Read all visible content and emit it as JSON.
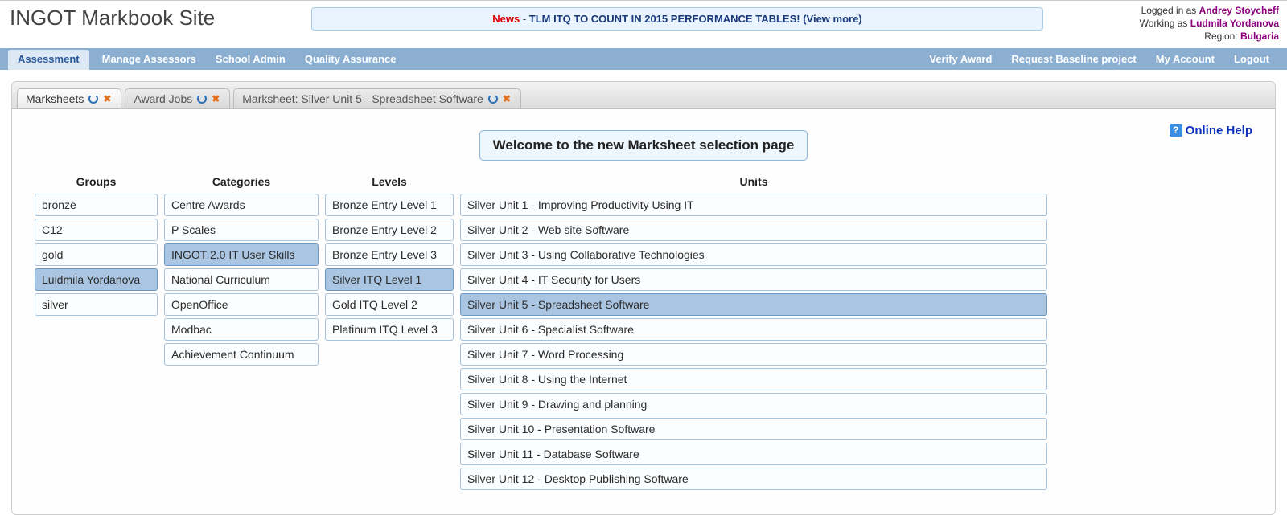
{
  "header": {
    "site_title": "INGOT Markbook Site",
    "news_label": "News",
    "news_sep": " - ",
    "news_text": "TLM ITQ TO COUNT IN 2015 PERFORMANCE TABLES! (View more)",
    "logged_in_as_label": "Logged in as ",
    "logged_in_user": "Andrey Stoycheff",
    "working_as_label": "Working as ",
    "working_as_user": "Ludmila Yordanova",
    "region_label": "Region: ",
    "region_value": "Bulgaria"
  },
  "nav": {
    "left": [
      "Assessment",
      "Manage Assessors",
      "School Admin",
      "Quality Assurance"
    ],
    "right": [
      "Verify Award",
      "Request Baseline project",
      "My Account",
      "Logout"
    ],
    "active_index": 0
  },
  "tabs": [
    {
      "label": "Marksheets",
      "active": true
    },
    {
      "label": "Award Jobs",
      "active": false
    },
    {
      "label": "Marksheet: Silver Unit 5 - Spreadsheet Software",
      "active": false
    }
  ],
  "page": {
    "welcome": "Welcome to the new Marksheet selection page",
    "help_label": "Online Help"
  },
  "columns": {
    "groups": {
      "header": "Groups",
      "items": [
        "bronze",
        "C12",
        "gold",
        "Luidmila Yordanova",
        "silver"
      ],
      "selected_index": 3
    },
    "categories": {
      "header": "Categories",
      "items": [
        "Centre Awards",
        "P Scales",
        "INGOT 2.0 IT User Skills",
        "National Curriculum",
        "OpenOffice",
        "Modbac",
        "Achievement Continuum"
      ],
      "selected_index": 2
    },
    "levels": {
      "header": "Levels",
      "items": [
        "Bronze Entry Level 1",
        "Bronze Entry Level 2",
        "Bronze Entry Level 3",
        "Silver ITQ Level 1",
        "Gold ITQ Level 2",
        "Platinum ITQ Level 3"
      ],
      "selected_index": 3
    },
    "units": {
      "header": "Units",
      "items": [
        "Silver Unit 1 - Improving Productivity Using IT",
        "Silver Unit 2 - Web site Software",
        "Silver Unit 3 - Using Collaborative Technologies",
        "Silver Unit 4 - IT Security for Users",
        "Silver Unit 5 - Spreadsheet Software",
        "Silver Unit 6 - Specialist Software",
        "Silver Unit 7 - Word Processing",
        "Silver Unit 8 - Using the Internet",
        "Silver Unit 9 - Drawing and planning",
        "Silver Unit 10 - Presentation Software",
        "Silver Unit 11 - Database Software",
        "Silver Unit 12 - Desktop Publishing Software"
      ],
      "selected_index": 4
    }
  }
}
